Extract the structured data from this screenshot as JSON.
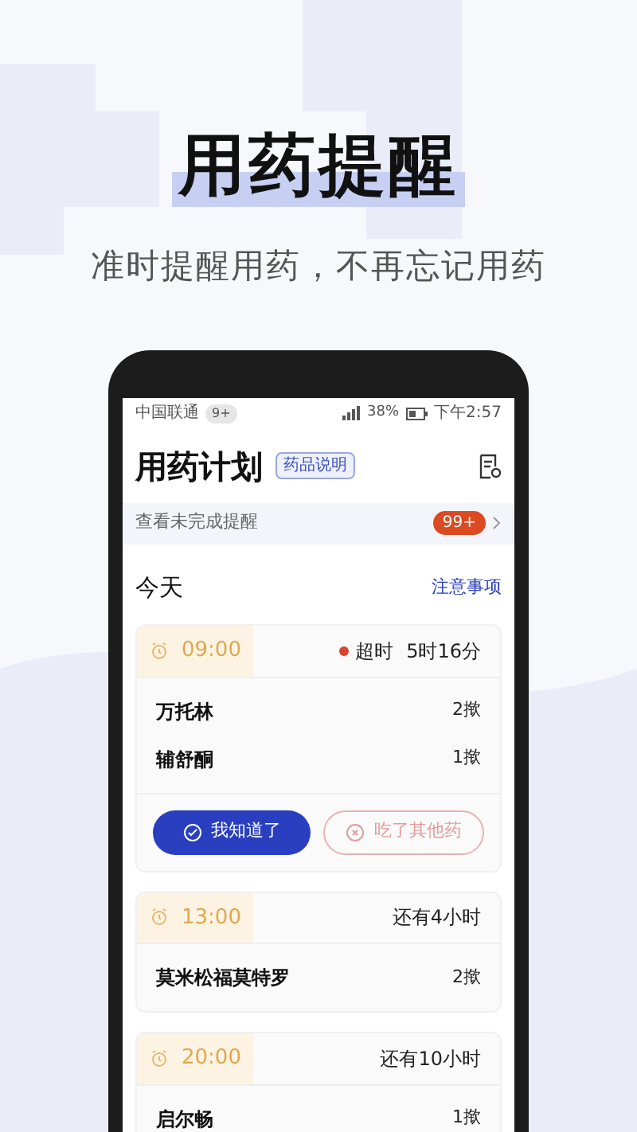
{
  "hero": {
    "title": "用药提醒",
    "subtitle": "准时提醒用药，不再忘记用药"
  },
  "status_bar": {
    "carrier": "中国联通",
    "carrier_badge": "9+",
    "battery": "38%",
    "time": "下午2:57"
  },
  "header": {
    "title": "用药计划",
    "tag": "药品说明"
  },
  "banner": {
    "text": "查看未完成提醒",
    "count": "99+"
  },
  "section": {
    "title": "今天",
    "link": "注意事项"
  },
  "reminders": [
    {
      "time": "09:00",
      "overdue": true,
      "status": "超时",
      "remaining": "5时16分",
      "medicines": [
        {
          "name": "万托林",
          "dose": "2揿"
        },
        {
          "name": "辅舒酮",
          "dose": "1揿"
        }
      ],
      "actions": [
        {
          "label": "我知道了",
          "kind": "primary"
        },
        {
          "label": "吃了其他药",
          "kind": "secondary"
        }
      ]
    },
    {
      "time": "13:00",
      "overdue": false,
      "remaining": "还有4小时",
      "medicines": [
        {
          "name": "莫米松福莫特罗",
          "dose": "2揿"
        }
      ]
    },
    {
      "time": "20:00",
      "overdue": false,
      "remaining": "还有10小时",
      "medicines": [
        {
          "name": "启尔畅",
          "dose": "1揿"
        }
      ]
    }
  ]
}
